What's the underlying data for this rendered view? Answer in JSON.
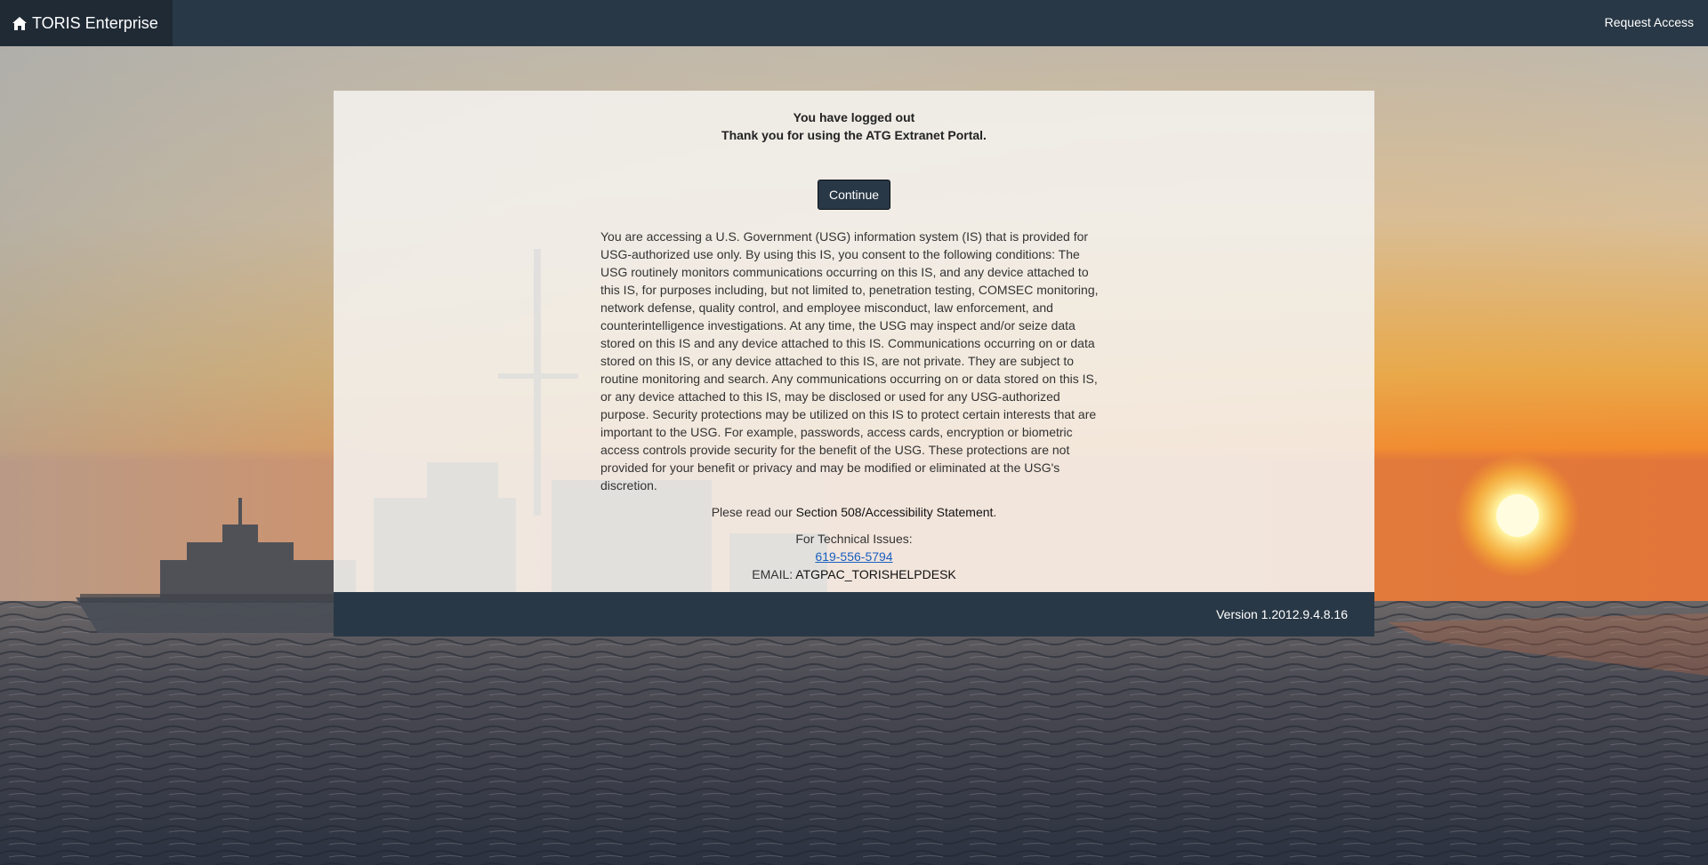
{
  "navbar": {
    "brand_icon": "home-icon",
    "brand_label": "TORIS Enterprise",
    "request_access_label": "Request Access"
  },
  "panel": {
    "logout_line1": "You have logged out",
    "logout_line2": "Thank you for using the ATG Extranet Portal.",
    "continue_label": "Continue",
    "notice_text": "You are accessing a U.S. Government (USG) information system (IS) that is provided for USG-authorized use only. By using this IS, you consent to the following conditions: The USG routinely monitors communications occurring on this IS, and any device attached to this IS, for purposes including, but not limited to, penetration testing, COMSEC monitoring, network defense, quality control, and employee misconduct, law enforcement, and counterintelligence investigations. At any time, the USG may inspect and/or seize data stored on this IS and any device attached to this IS. Communications occurring on or data stored on this IS, or any device attached to this IS, are not private. They are subject to routine monitoring and search. Any communications occurring on or data stored on this IS, or any device attached to this IS, may be disclosed or used for any USG-authorized purpose. Security protections may be utilized on this IS to protect certain interests that are important to the USG. For example, passwords, access cards, encryption or biometric access controls provide security for the benefit of the USG. These protections are not provided for your benefit or privacy and may be modified or eliminated at the USG's discretion.",
    "accessibility_prefix": "Plese read our ",
    "accessibility_link": "Section 508/Accessibility Statement",
    "accessibility_suffix": ".",
    "tech_label": "For Technical Issues:",
    "phone": "619-556-5794",
    "email_label": "EMAIL: ",
    "email_value": "ATGPAC_TORISHELPDESK"
  },
  "footer": {
    "version": "Version 1.2012.9.4.8.16"
  },
  "colors": {
    "navbar": "#293846",
    "brand_bg": "#1f2a35",
    "link": "#1a5fbf"
  }
}
